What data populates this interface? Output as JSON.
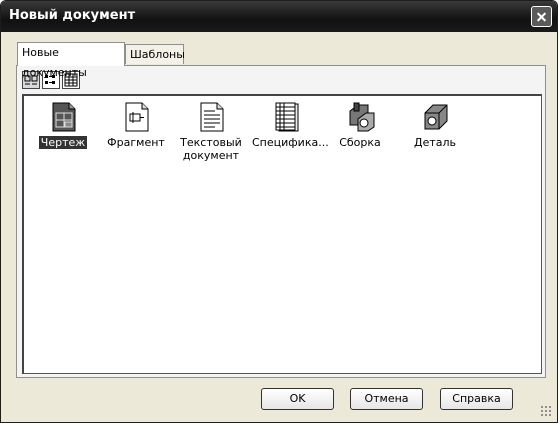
{
  "window": {
    "title": "Новый документ"
  },
  "tabs": [
    {
      "label": "Новые документы",
      "active": true
    },
    {
      "label": "Шаблоны",
      "active": false
    }
  ],
  "view_buttons": [
    {
      "icon": "large-icons-view-icon",
      "pressed": true
    },
    {
      "icon": "small-icons-view-icon",
      "pressed": false
    },
    {
      "icon": "details-view-icon",
      "pressed": false
    }
  ],
  "documents": [
    {
      "label": "Чертеж",
      "icon": "drawing-icon",
      "selected": true
    },
    {
      "label": "Фрагмент",
      "icon": "fragment-icon",
      "selected": false
    },
    {
      "label": "Текстовый документ",
      "icon": "text-document-icon",
      "selected": false
    },
    {
      "label": "Специфика...",
      "icon": "specification-icon",
      "selected": false
    },
    {
      "label": "Сборка",
      "icon": "assembly-icon",
      "selected": false
    },
    {
      "label": "Деталь",
      "icon": "part-icon",
      "selected": false
    }
  ],
  "buttons": {
    "ok": "OK",
    "cancel": "Отмена",
    "help": "Справка"
  }
}
